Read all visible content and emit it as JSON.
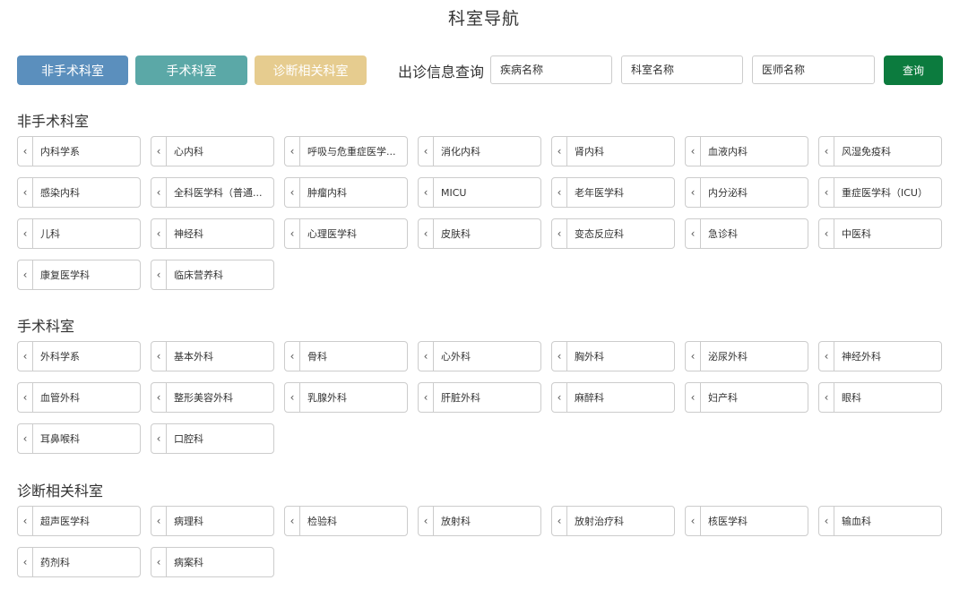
{
  "page": {
    "title": "科室导航"
  },
  "category_buttons": [
    {
      "label": "非手术科室",
      "color": "#5b8fbd"
    },
    {
      "label": "手术科室",
      "color": "#5ba8a7"
    },
    {
      "label": "诊断相关科室",
      "color": "#e6cc8f"
    }
  ],
  "search": {
    "label": "出诊信息查询",
    "disease_placeholder": "疾病名称",
    "department_placeholder": "科室名称",
    "doctor_placeholder": "医师名称",
    "button_label": "查询",
    "button_color": "#0c7b3e"
  },
  "icons": {
    "item_chevron": "chevron-left-icon"
  },
  "sections": [
    {
      "title": "非手术科室",
      "departments": [
        "内科学系",
        "心内科",
        "呼吸与危重症医学...",
        "消化内科",
        "肾内科",
        "血液内科",
        "风湿免疫科",
        "感染内科",
        "全科医学科（普通...",
        "肿瘤内科",
        "MICU",
        "老年医学科",
        "内分泌科",
        "重症医学科（ICU）",
        "儿科",
        "神经科",
        "心理医学科",
        "皮肤科",
        "变态反应科",
        "急诊科",
        "中医科",
        "康复医学科",
        "临床营养科"
      ]
    },
    {
      "title": "手术科室",
      "departments": [
        "外科学系",
        "基本外科",
        "骨科",
        "心外科",
        "胸外科",
        "泌尿外科",
        "神经外科",
        "血管外科",
        "整形美容外科",
        "乳腺外科",
        "肝脏外科",
        "麻醉科",
        "妇产科",
        "眼科",
        "耳鼻喉科",
        "口腔科"
      ]
    },
    {
      "title": "诊断相关科室",
      "departments": [
        "超声医学科",
        "病理科",
        "检验科",
        "放射科",
        "放射治疗科",
        "核医学科",
        "输血科",
        "药剂科",
        "病案科"
      ]
    }
  ]
}
